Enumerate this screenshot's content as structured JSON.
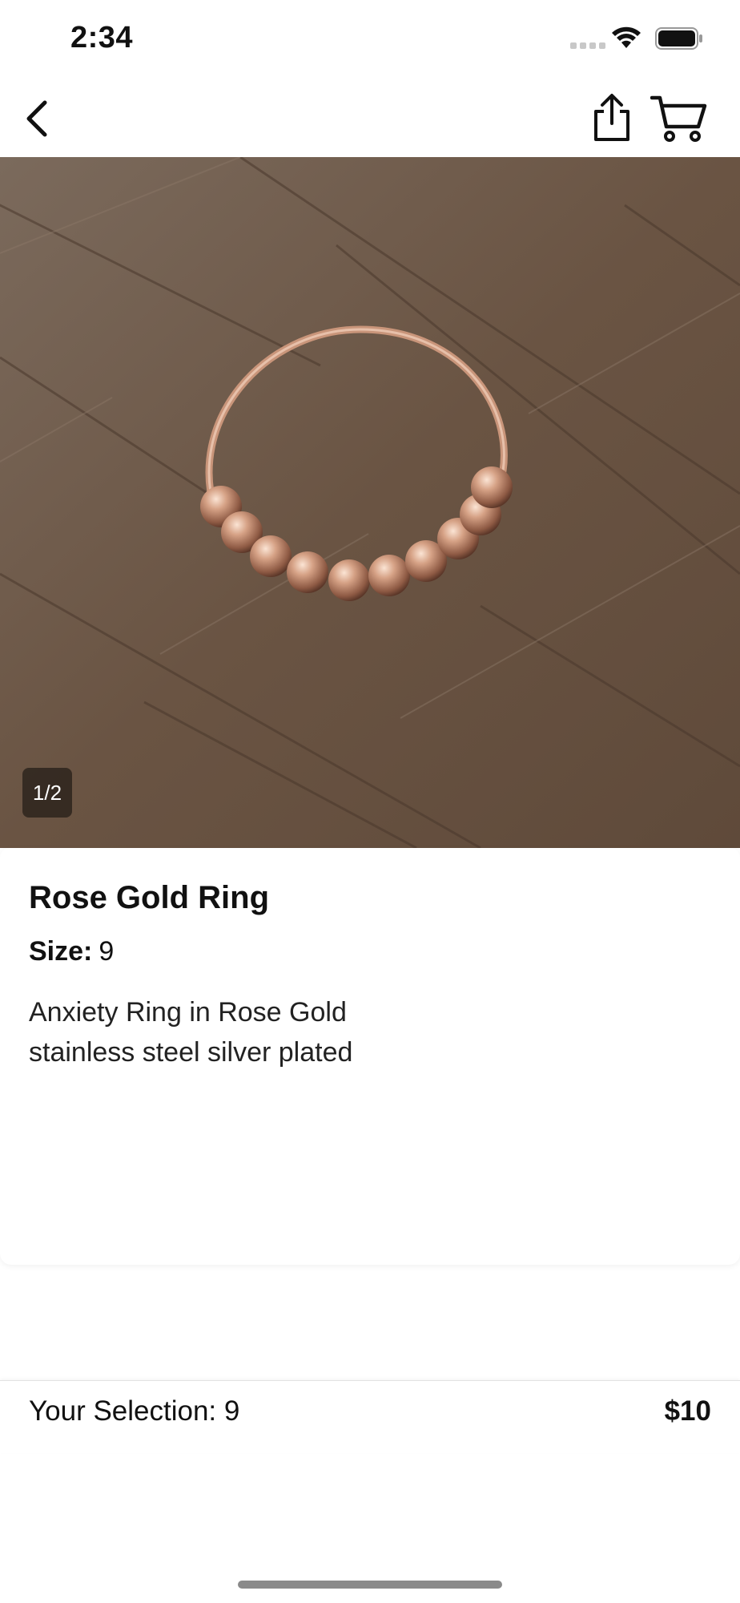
{
  "status_bar": {
    "time": "2:34"
  },
  "nav": {
    "back_icon": "chevron-left-icon",
    "share_icon": "share-icon",
    "cart_icon": "cart-icon"
  },
  "gallery": {
    "indicator": "1/2"
  },
  "product": {
    "title": "Rose Gold Ring",
    "size_label": "Size:",
    "size_value": "9",
    "description_line1": "Anxiety Ring in Rose Gold",
    "description_line2": "stainless steel silver plated"
  },
  "selection": {
    "label": "Your Selection: 9",
    "price": "$10"
  },
  "colors": {
    "wood": "#6e5a49",
    "ring": "#c9957a"
  }
}
